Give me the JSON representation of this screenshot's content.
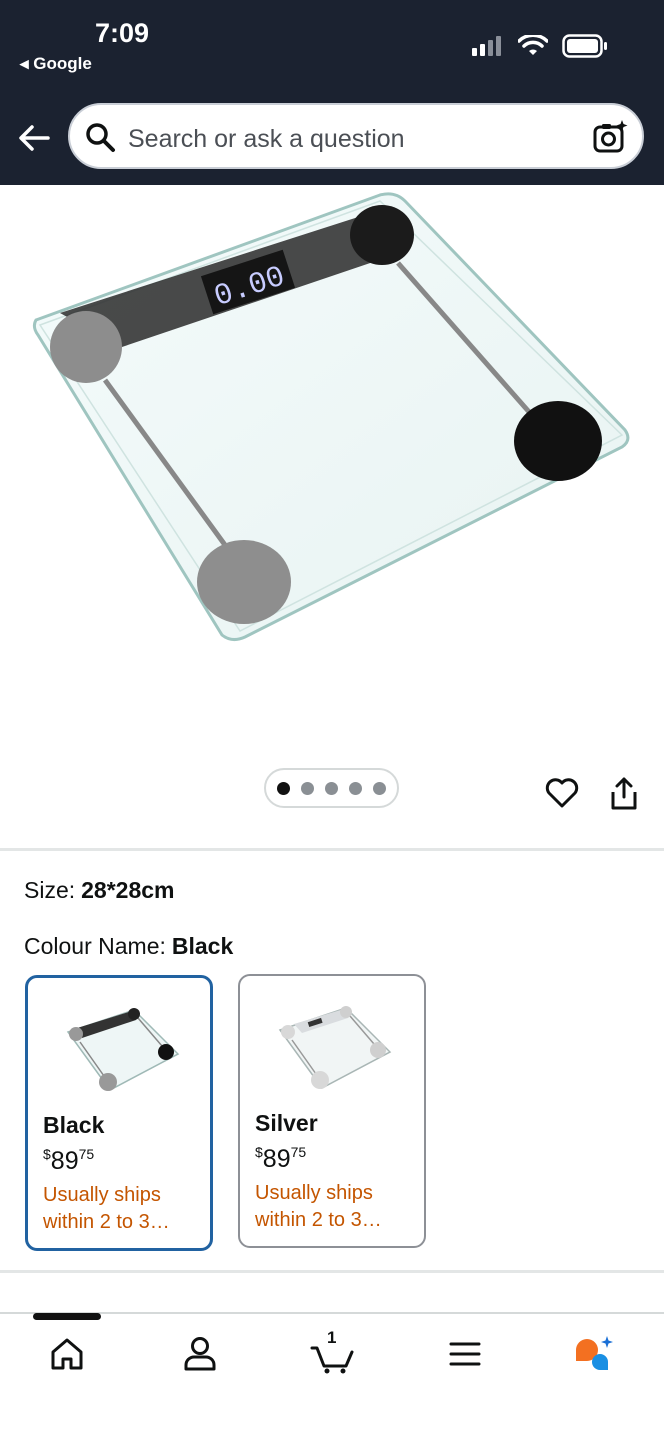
{
  "status": {
    "time": "7:09",
    "back_app": "◂ Google"
  },
  "search": {
    "placeholder": "Search or ask a question"
  },
  "gallery": {
    "pages": 5,
    "active_page": 1
  },
  "variation": {
    "size_label": "Size:",
    "size_value": "28*28cm",
    "colour_label": "Colour Name:",
    "colour_value": "Black"
  },
  "swatches": [
    {
      "name": "Black",
      "currency": "$",
      "price_main": "89",
      "price_cents": "75",
      "shipping": "Usually ships within 2 to 3…",
      "selected": true
    },
    {
      "name": "Silver",
      "currency": "$",
      "price_main": "89",
      "price_cents": "75",
      "shipping": "Usually ships within 2 to 3…",
      "selected": false
    }
  ],
  "nav": {
    "cart_count": "1"
  },
  "colors": {
    "header_bg": "#1b2230",
    "selected_border": "#2162a1",
    "shipping_text": "#c45500"
  }
}
